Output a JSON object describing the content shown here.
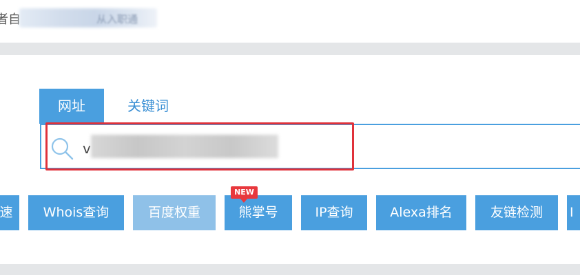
{
  "header": {
    "partial_label": "者自",
    "blurred_text": "从入职通"
  },
  "search": {
    "tabs": [
      {
        "label": "网址",
        "active": true
      },
      {
        "label": "关键词",
        "active": false
      }
    ],
    "input_value": "v",
    "border_color": "#4a9fdf",
    "highlight_color": "#e0313a"
  },
  "tools": {
    "badge": "NEW",
    "buttons": [
      {
        "label": "速"
      },
      {
        "label": "Whois查询"
      },
      {
        "label": "百度权重"
      },
      {
        "label": "熊掌号"
      },
      {
        "label": "IP查询"
      },
      {
        "label": "Alexa排名"
      },
      {
        "label": "友链检测"
      },
      {
        "label": "I"
      }
    ]
  },
  "colors": {
    "accent": "#4a9fdf",
    "accent_light": "#8fc1e8",
    "divider": "#e4e6e8",
    "badge": "#e8383d"
  }
}
